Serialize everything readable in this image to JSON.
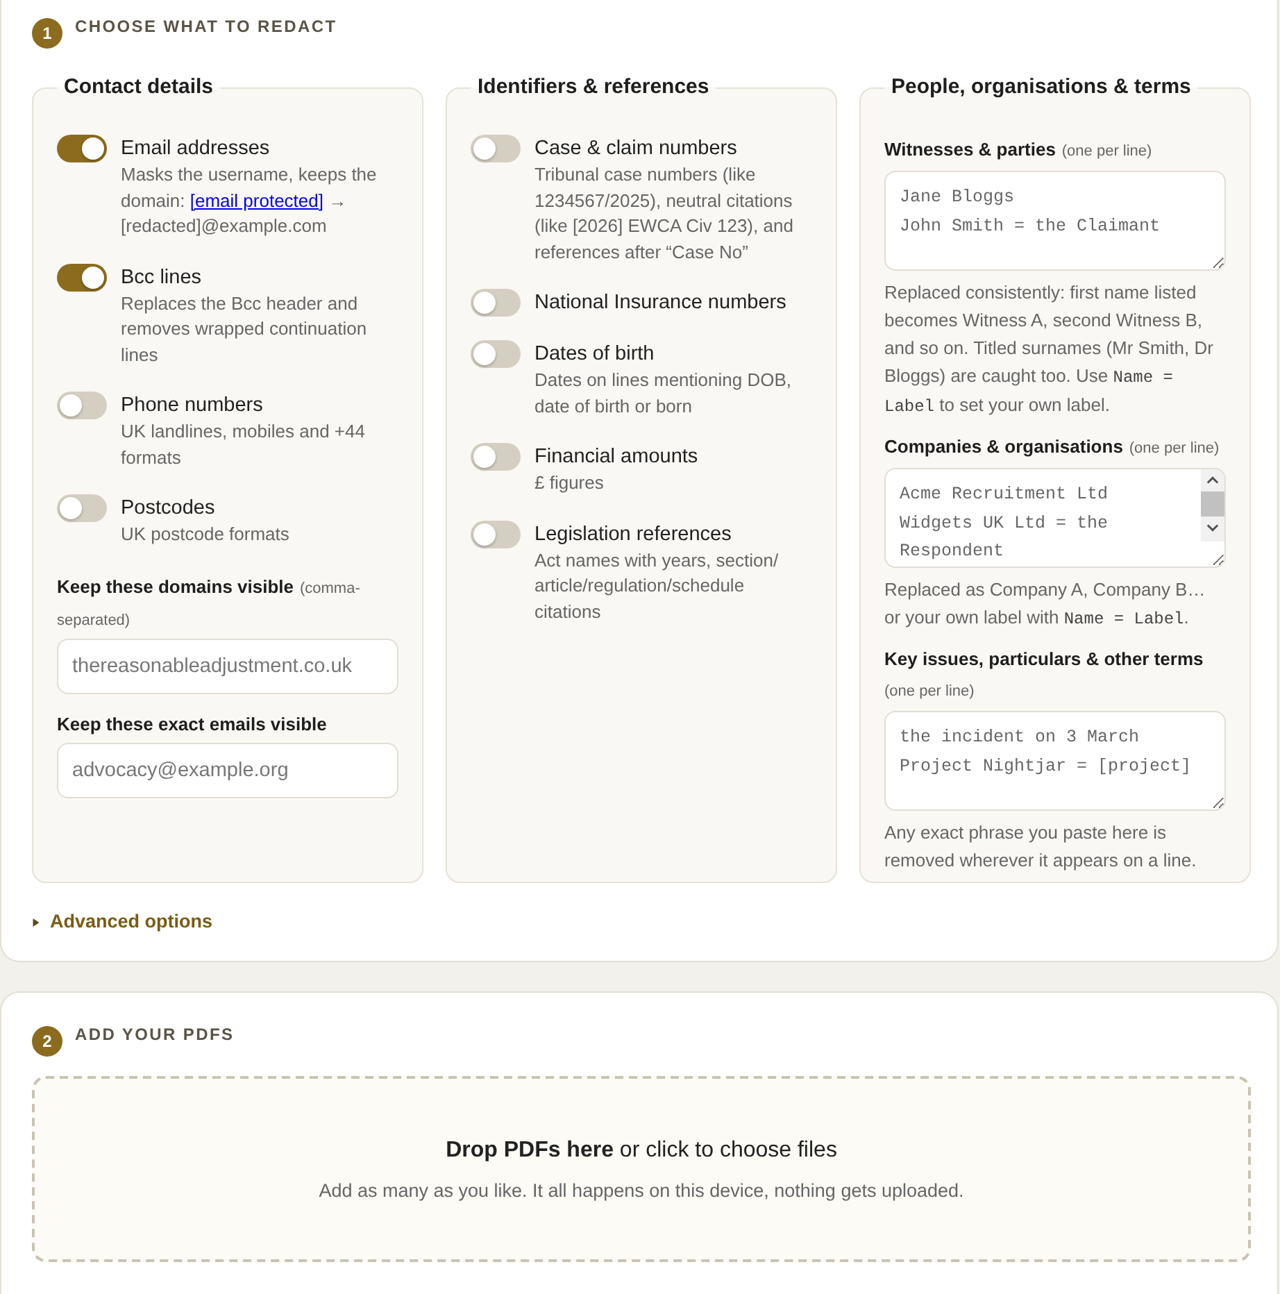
{
  "sections": [
    {
      "number": "1",
      "title": "CHOOSE WHAT TO REDACT",
      "groups": [
        {
          "title": "Contact details",
          "items": [
            {
              "kind": "toggle",
              "label": "Email addresses",
              "on": true,
              "description": [
                {
                  "kind": "text",
                  "text": "Masks the username, keeps the domain: "
                },
                {
                  "kind": "link",
                  "text": "[email protected]"
                },
                {
                  "kind": "text",
                  "text": " → [redacted]@example.com"
                }
              ]
            },
            {
              "kind": "toggle",
              "label": "Bcc lines",
              "on": true,
              "description": "Replaces the Bcc header and removes wrapped continuation lines"
            },
            {
              "kind": "toggle",
              "label": "Phone numbers",
              "on": false,
              "description": "UK landlines, mobiles and +44 formats"
            },
            {
              "kind": "toggle",
              "label": "Postcodes",
              "on": false,
              "description": "UK postcode formats"
            },
            {
              "kind": "input",
              "label": "Keep these domains visible",
              "hint": "(comma-separated)",
              "placeholder": "thereasonableadjustment.co.uk"
            },
            {
              "kind": "input",
              "label": "Keep these exact emails visible",
              "placeholder": "advocacy@example.org"
            }
          ]
        },
        {
          "title": "Identifiers & references",
          "items": [
            {
              "kind": "toggle",
              "label": "Case & claim numbers",
              "on": false,
              "description": "Tribunal case numbers (like 1234567/2025), neutral citations (like [2026] EWCA Civ 123), and references after “Case No”"
            },
            {
              "kind": "toggle",
              "label": "National Insurance numbers",
              "on": false
            },
            {
              "kind": "toggle",
              "label": "Dates of birth",
              "on": false,
              "description": "Dates on lines mentioning DOB, date of birth or born"
            },
            {
              "kind": "toggle",
              "label": "Financial amounts",
              "on": false,
              "description": "£ figures"
            },
            {
              "kind": "toggle",
              "label": "Legislation references",
              "on": false,
              "description": "Act names with years, section/article/regulation/schedule citations"
            }
          ]
        },
        {
          "title": "People, organisations & terms",
          "items": [
            {
              "kind": "textarea",
              "label": "Witnesses & parties",
              "hint": "(one per line)",
              "placeholder": "Jane Bloggs\nJohn Smith = the Claimant",
              "help": [
                {
                  "kind": "text",
                  "text": "Replaced consistently: first name listed becomes Witness A, second Witness B, and so on. Titled surnames (Mr Smith, Dr Bloggs) are caught too. Use "
                },
                {
                  "kind": "code",
                  "text": "Name = Label"
                },
                {
                  "kind": "text",
                  "text": " to set your own label."
                }
              ]
            },
            {
              "kind": "textarea",
              "label": "Companies & organisations",
              "hint": "(one per line)",
              "placeholder": "Acme Recruitment Ltd\nWidgets UK Ltd = the Respondent",
              "help": [
                {
                  "kind": "text",
                  "text": "Replaced as Company A, Company B… or your own label with "
                },
                {
                  "kind": "code",
                  "text": "Name = Label"
                },
                {
                  "kind": "text",
                  "text": "."
                }
              ]
            },
            {
              "kind": "textarea",
              "label": "Key issues, particulars & other terms",
              "hint": "(one per line)",
              "placeholder": "the incident on 3 March\nProject Nightjar = [project]",
              "help": "Any exact phrase you paste here is removed wherever it appears on a line."
            }
          ]
        }
      ],
      "advanced": {
        "label": "Advanced options",
        "expanded": false
      }
    },
    {
      "number": "2",
      "title": "ADD YOUR PDFS",
      "dropzone": {
        "title": "**Drop PDFs here** or click to choose files",
        "hint": "Add as many as you like. It all happens on this device, nothing gets uploaded."
      }
    }
  ]
}
